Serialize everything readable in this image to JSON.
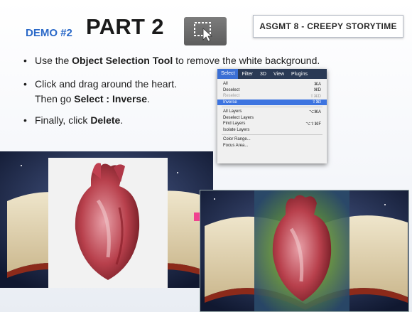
{
  "header": {
    "demo_label": "DEMO #2",
    "part_title": "PART 2",
    "assignment": "ASGMT 8 - CREEPY STORYTIME"
  },
  "bullets": [
    {
      "pre": "Use the ",
      "bold": "Object Selection Tool",
      "post": " to remove the white background."
    },
    {
      "pre": "Click and drag around the heart.",
      "bold": "",
      "post": ""
    },
    {
      "pre": "Then go ",
      "bold": "Select : Inverse",
      "post": "."
    },
    {
      "pre": "Finally, click ",
      "bold": "Delete",
      "post": "."
    }
  ],
  "bullet_char": "•",
  "select_menu": {
    "menubar": [
      "Select",
      "Filter",
      "3D",
      "View",
      "Plugins"
    ],
    "items": [
      {
        "label": "All",
        "shortcut": "⌘A",
        "state": "normal"
      },
      {
        "label": "Deselect",
        "shortcut": "⌘D",
        "state": "normal"
      },
      {
        "label": "Reselect",
        "shortcut": "⇧⌘D",
        "state": "dim"
      },
      {
        "label": "Inverse",
        "shortcut": "⇧⌘I",
        "state": "highlight"
      },
      {
        "label": "All Layers",
        "shortcut": "⌥⌘A",
        "state": "normal"
      },
      {
        "label": "Deselect Layers",
        "shortcut": "",
        "state": "normal"
      },
      {
        "label": "Find Layers",
        "shortcut": "⌥⇧⌘F",
        "state": "normal"
      },
      {
        "label": "Isolate Layers",
        "shortcut": "",
        "state": "normal"
      },
      {
        "label": "Color Range...",
        "shortcut": "",
        "state": "normal"
      },
      {
        "label": "Focus Area...",
        "shortcut": "",
        "state": "normal"
      }
    ]
  },
  "colors": {
    "demo_blue": "#2b69c8",
    "arrow_pink": "#f0438f",
    "menu_highlight": "#3d74e0",
    "space_bg": "#1c2a4d"
  }
}
